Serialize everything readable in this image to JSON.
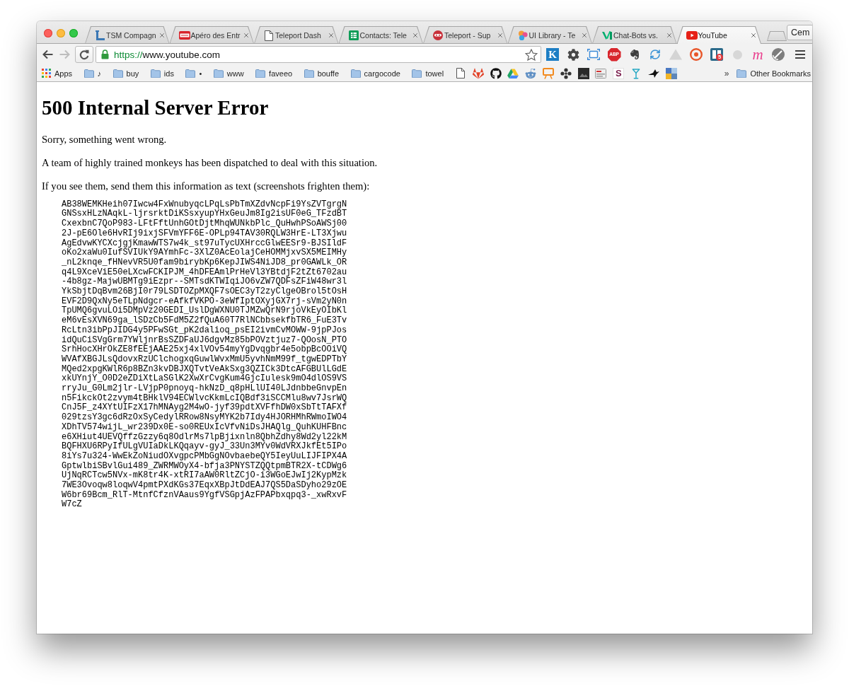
{
  "tabs": [
    {
      "title": "TSM Compagn",
      "selected": false
    },
    {
      "title": "Apéro des Entr",
      "selected": false
    },
    {
      "title": "Teleport Dash",
      "selected": false
    },
    {
      "title": "Contacts: Tele",
      "selected": false
    },
    {
      "title": "Teleport - Sup",
      "selected": false
    },
    {
      "title": "UI Library - Te",
      "selected": false
    },
    {
      "title": "Chat-Bots vs.",
      "selected": false
    },
    {
      "title": "YouTube",
      "selected": true
    }
  ],
  "profile": {
    "name": "Cem"
  },
  "toolbar": {
    "back_enabled": true,
    "forward_enabled": false,
    "address": {
      "scheme": "https://",
      "host": "www.youtube.com",
      "secure": true
    },
    "extensions": [
      {
        "kind": "tile",
        "label": "K"
      },
      {
        "kind": "icon"
      },
      {
        "kind": "icon"
      },
      {
        "kind": "stop",
        "label": "ABP"
      },
      {
        "kind": "icon"
      },
      {
        "kind": "icon"
      },
      {
        "kind": "icon"
      },
      {
        "kind": "icon"
      },
      {
        "kind": "badge",
        "label": "5"
      },
      {
        "kind": "icon"
      },
      {
        "kind": "script",
        "label": "m"
      },
      {
        "kind": "icon"
      }
    ]
  },
  "bookmarks": {
    "items": [
      {
        "kind": "apps",
        "label": "Apps"
      },
      {
        "kind": "folder",
        "label": "♪"
      },
      {
        "kind": "folder",
        "label": "buy"
      },
      {
        "kind": "folder",
        "label": "ids"
      },
      {
        "kind": "folder",
        "label": "•"
      },
      {
        "kind": "folder",
        "label": "www"
      },
      {
        "kind": "folder",
        "label": "faveeo"
      },
      {
        "kind": "folder",
        "label": "bouffe"
      },
      {
        "kind": "folder",
        "label": "cargocode"
      },
      {
        "kind": "folder",
        "label": "towel"
      },
      {
        "kind": "site"
      },
      {
        "kind": "site"
      },
      {
        "kind": "site"
      },
      {
        "kind": "site"
      },
      {
        "kind": "site"
      },
      {
        "kind": "site"
      },
      {
        "kind": "site"
      },
      {
        "kind": "site"
      },
      {
        "kind": "site"
      },
      {
        "kind": "letter",
        "label": "S"
      },
      {
        "kind": "site"
      },
      {
        "kind": "site"
      },
      {
        "kind": "site"
      }
    ],
    "overflow": "»",
    "other": {
      "label": "Other Bookmarks"
    }
  },
  "page": {
    "heading": "500 Internal Server Error",
    "paragraphs": [
      "Sorry, something went wrong.",
      "A team of highly trained monkeys has been dispatched to deal with this situation.",
      "If you see them, send them this information as text (screenshots frighten them):"
    ],
    "debug_info": [
      "AB38WEMKHeih07Iwcw4FxWnubyqcLPqLsPbTmXZdvNcpFi9YsZVTgrgN",
      "GNSsxHLzNAqkL-ljrsrktDiKSsxyupYHxGeuJm8Ig2isUF0eG_TFzdBT",
      "CxexbnC7QoP983-LFtFftUnhGOtDjtMhqWUNkbPlc_QuHwhPSoAWSj00",
      "2J-pE6Ole6HvRIj9ixjSFVmYFF6E-OPLp94TAV30RQLW3HrE-LT3Xjwu",
      "AgEdvwKYCXcjgjKmawWTS7w4k_st97uTycUXHrccGlwEESr9-BJSIldF",
      "oKo2xaWu0IufSVIUkY9AYmhFc-3XlZ0AcEolajCeHOMMjxvSX5MEIMHy",
      "_nL2knqe_fHNevVR5U0fam9birybKp6KepJIWS4NiJD8_pr0GAWLk_OR",
      "q4L9XceViE50eLXcwFCKIPJM_4hDFEAmlPrHeVl3YBtdjF2tZt6702au",
      "-4b8gz-MajwUBMTg9iEzpr--SMTsdKTWIqiJO6vZW7QDFsZFiW48wr3l",
      "YkSbjtDqBvm26BjI0r79LSDTOZpMXQF7sOEC3yT2zyClgeOBrol5tOsH",
      "EVF2D9QxNy5eTLpNdgcr-eAfkfVKPO-3eWfIptOXyjGX7rj-sVm2yN0n",
      "TpUMQ6gvuLOi5DMpVz20GEDI_UslDgWXNU0TJMZwQrN9rjoVkEyOIbKl",
      "eM6vEsXVN69ga_lSDzCb5FdM5Z2fQuA60T7RlNCbbsekfbTR6_FuE3Tv",
      "RcLtn3ibPpJIDG4y5PFwSGt_pK2dalioq_psEI2ivmCvMOWW-9jpPJos",
      "idQuCiSVgGrm7YWljnrBsSZDFaUJ6dgvMz85bPOVztjuz7-QOosN_PTO",
      "SrhHocXHrOkZE8fEEjAAE25xj4xlVOv54myYgDvqgbr4e5obpBcOOiVQ",
      "WVAfXBGJLsQdovxRzUClchogxqGuwlWvxMmU5yvhNmM99f_tgwEDPTbY",
      "MQed2xpgKWlR6p8BZn3kvDBJXQTvtVeAkSxg3QZICk3DtcAFGBUlLGdE",
      "xkUYnjY_O0D2eZDiXtLaSGlK2XwXrCvgKum4GjcIulesk9mO4dlOS9VS",
      "rryJu_G0Lm2jlr-LVjpP0pnoyq-hkNzD_q8pHLlUI40LJdnbbeGnvpEn",
      "n5FikckOt2zvym4tBHklV94ECWlvcKkmLcIQBdf3iSCCMlu8wv7JsrWQ",
      "CnJ5F_z4XYtUIFzX17hMNAyg2M4wO-jyf39pdtXVFfhDW0xSbTtTAFXf",
      "029tzsY3gc6dRzOxSyCedylRRow8NsyMYK2b7Idy4HJORHMhRWmoIWO4",
      "XDhTV574wijL_wr239Dx0E-so0REUxIcVfvNiDsJHAQlg_QuhKUHFBnc",
      "e6XHiut4UEVQffzGzzy6q8OdlrMs7lpBjixnln8QbhZdhy8Wd2yl22kM",
      "BQFHXU6RPyIfULgVUIaDkLKQqayv-gyJ_33Un3MYv0WdVRXJkfEt5IPo",
      "8iYs7u324-WwEkZoNiudOXvgpcPMbGgNOvbaebeQY5IeyUuLIJFIPX4A",
      "GptwlbiSBvlGui489_ZWRMWOyX4-bfja3PNYSTZQQtpmBTR2X-tCDWg6",
      "UjNqRCTcw5NVx-mK8tr4K-xtRI7aAW0RltZCjO-i3WGoEJwIj2KypMzk",
      "7WE3Ovoqw8loqwV4pmtPXdKGs37EqxXBpJtDdEAJ7QS5DaSDyho29zOE",
      "W6br69Bcm_RlT-MtnfCfznVAaus9YgfVSGpjAzFPAPbxqpq3-_xwRxvF",
      "W7cZ"
    ]
  }
}
